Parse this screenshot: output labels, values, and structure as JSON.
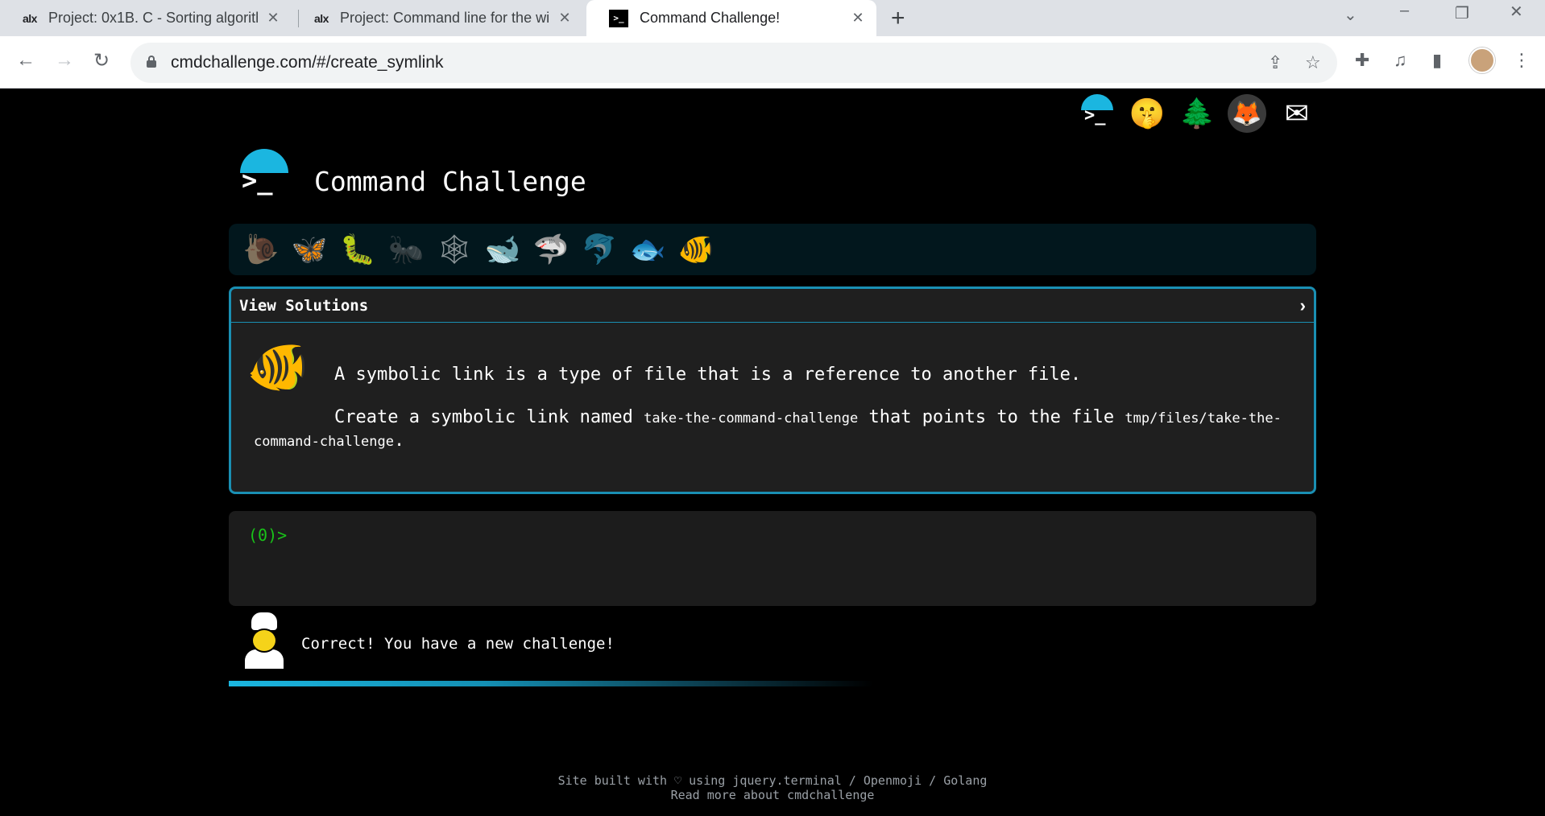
{
  "browser": {
    "tabs": [
      {
        "favicon": "alx",
        "title": "Project: 0x1B. C - Sorting algorith",
        "close": "✕"
      },
      {
        "favicon": "alx",
        "title": "Project: Command line for the wi",
        "close": "✕"
      },
      {
        "favicon": "terminal-icon",
        "title": "Command Challenge!",
        "close": "✕"
      }
    ],
    "new_tab": "+",
    "url": "cmdchallenge.com/#/create_symlink"
  },
  "site": {
    "title": "Command Challenge",
    "level_icons": [
      "snail-icon",
      "butterfly-icon",
      "caterpillar-icon",
      "ant-icon",
      "spider-web-icon",
      "whale-icon",
      "shark-icon",
      "dolphin-icon",
      "fish-icon",
      "tropical-fish-icon"
    ],
    "challenge": {
      "header": "View Solutions",
      "chevron": "›",
      "line1": "A symbolic link is a type of file that is a reference to another file.",
      "line2_pre": "Create a symbolic link named ",
      "line2_code1": "take-the-command-challenge",
      "line2_mid": " that points to the file ",
      "line2_code2": "tmp/files/take-the-command-challenge",
      "line2_post": "."
    },
    "prompt": "(0)>",
    "feedback": "Correct! You have a new challenge!",
    "footer": {
      "line1": "Site built with ♡ using jquery.terminal / Openmoji / Golang",
      "line2": "Read more about cmdchallenge"
    }
  }
}
